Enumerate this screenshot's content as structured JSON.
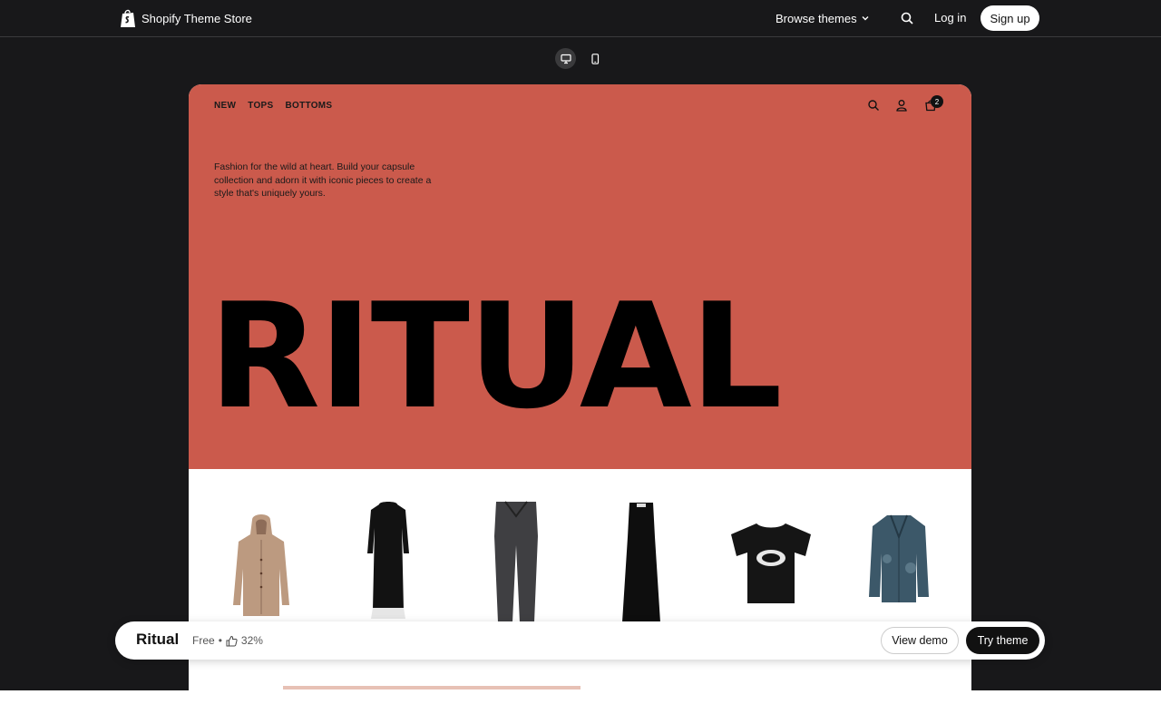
{
  "topnav": {
    "brand_name": "Shopify Theme Store",
    "browse_label": "Browse themes",
    "login_label": "Log in",
    "signup_label": "Sign up"
  },
  "preview": {
    "nav_items": [
      "NEW",
      "TOPS",
      "BOTTOMS"
    ],
    "cart_count": "2",
    "tagline": "Fashion for the wild at heart. Build your capsule collection and adorn it with iconic pieces to create a style that's uniquely yours.",
    "hero_title": "RITUAL",
    "hero_color": "#cb5a4c",
    "products": [
      "cardigan-hoodie",
      "black-long-dress",
      "grey-jeans",
      "black-maxi-skirt",
      "black-graphic-tee",
      "denim-jacket"
    ]
  },
  "themebar": {
    "name": "Ritual",
    "price": "Free",
    "separator": "•",
    "rating": "32%",
    "view_demo_label": "View demo",
    "try_theme_label": "Try theme"
  },
  "colors": {
    "background": "#18181a",
    "accent_dark": "#111111"
  }
}
